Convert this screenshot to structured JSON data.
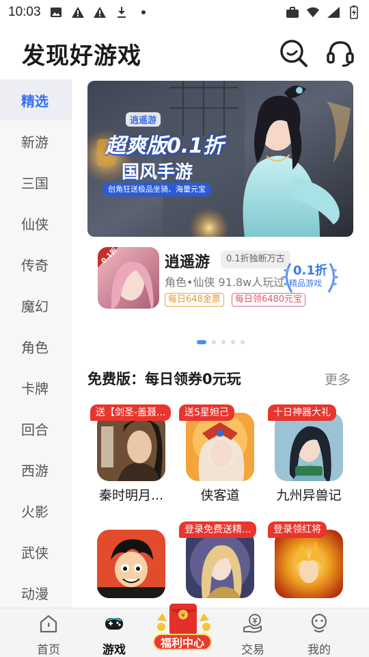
{
  "status_bar": {
    "time": "10:03"
  },
  "header": {
    "title": "发现好游戏"
  },
  "sidebar": {
    "items": [
      {
        "label": "精选"
      },
      {
        "label": "新游"
      },
      {
        "label": "三国"
      },
      {
        "label": "仙侠"
      },
      {
        "label": "传奇"
      },
      {
        "label": "魔幻"
      },
      {
        "label": "角色"
      },
      {
        "label": "卡牌"
      },
      {
        "label": "回合"
      },
      {
        "label": "西游"
      },
      {
        "label": "火影"
      },
      {
        "label": "武侠"
      },
      {
        "label": "动漫"
      }
    ],
    "selected": "精选"
  },
  "banner": {
    "logo_text": "逍遥游",
    "title_line1": "超爽版0.1折",
    "title_line2": "国风手游",
    "subtitle": "创角狂送极品坐骑、海量元宝"
  },
  "featured_game": {
    "name": "逍遥游",
    "tag": "0.1折独断万古",
    "meta": "角色•仙侠  91.8w人玩过",
    "badges": [
      "每日648金票",
      "每日领6480元宝"
    ],
    "discount_value": "0.1折",
    "discount_label": "精品游戏",
    "icon_badge": "0.1折"
  },
  "carousel": {
    "count": 5,
    "active_index": 0
  },
  "free_section": {
    "title": "免费版：每日领券0元玩",
    "more_label": "更多",
    "games": [
      {
        "name": "秦时明月...",
        "ribbon": "送【剑圣-盖聂..."
      },
      {
        "name": "侠客道",
        "ribbon": "送5星妲己"
      },
      {
        "name": "九州异兽记",
        "ribbon": "十日神器大礼"
      },
      {
        "name": "",
        "ribbon": ""
      },
      {
        "name": "",
        "ribbon": "登录免费送精..."
      },
      {
        "name": "",
        "ribbon": "登录领红将"
      }
    ]
  },
  "bottom_nav": {
    "items": [
      {
        "label": "首页"
      },
      {
        "label": "游戏"
      },
      {
        "label": "交易"
      },
      {
        "label": "我的"
      }
    ],
    "welfare_label": "福利中心",
    "active": "游戏"
  },
  "colors": {
    "accent": "#3a6ff0",
    "ribbon": "#e8352e",
    "gold": "#e39a2b"
  }
}
